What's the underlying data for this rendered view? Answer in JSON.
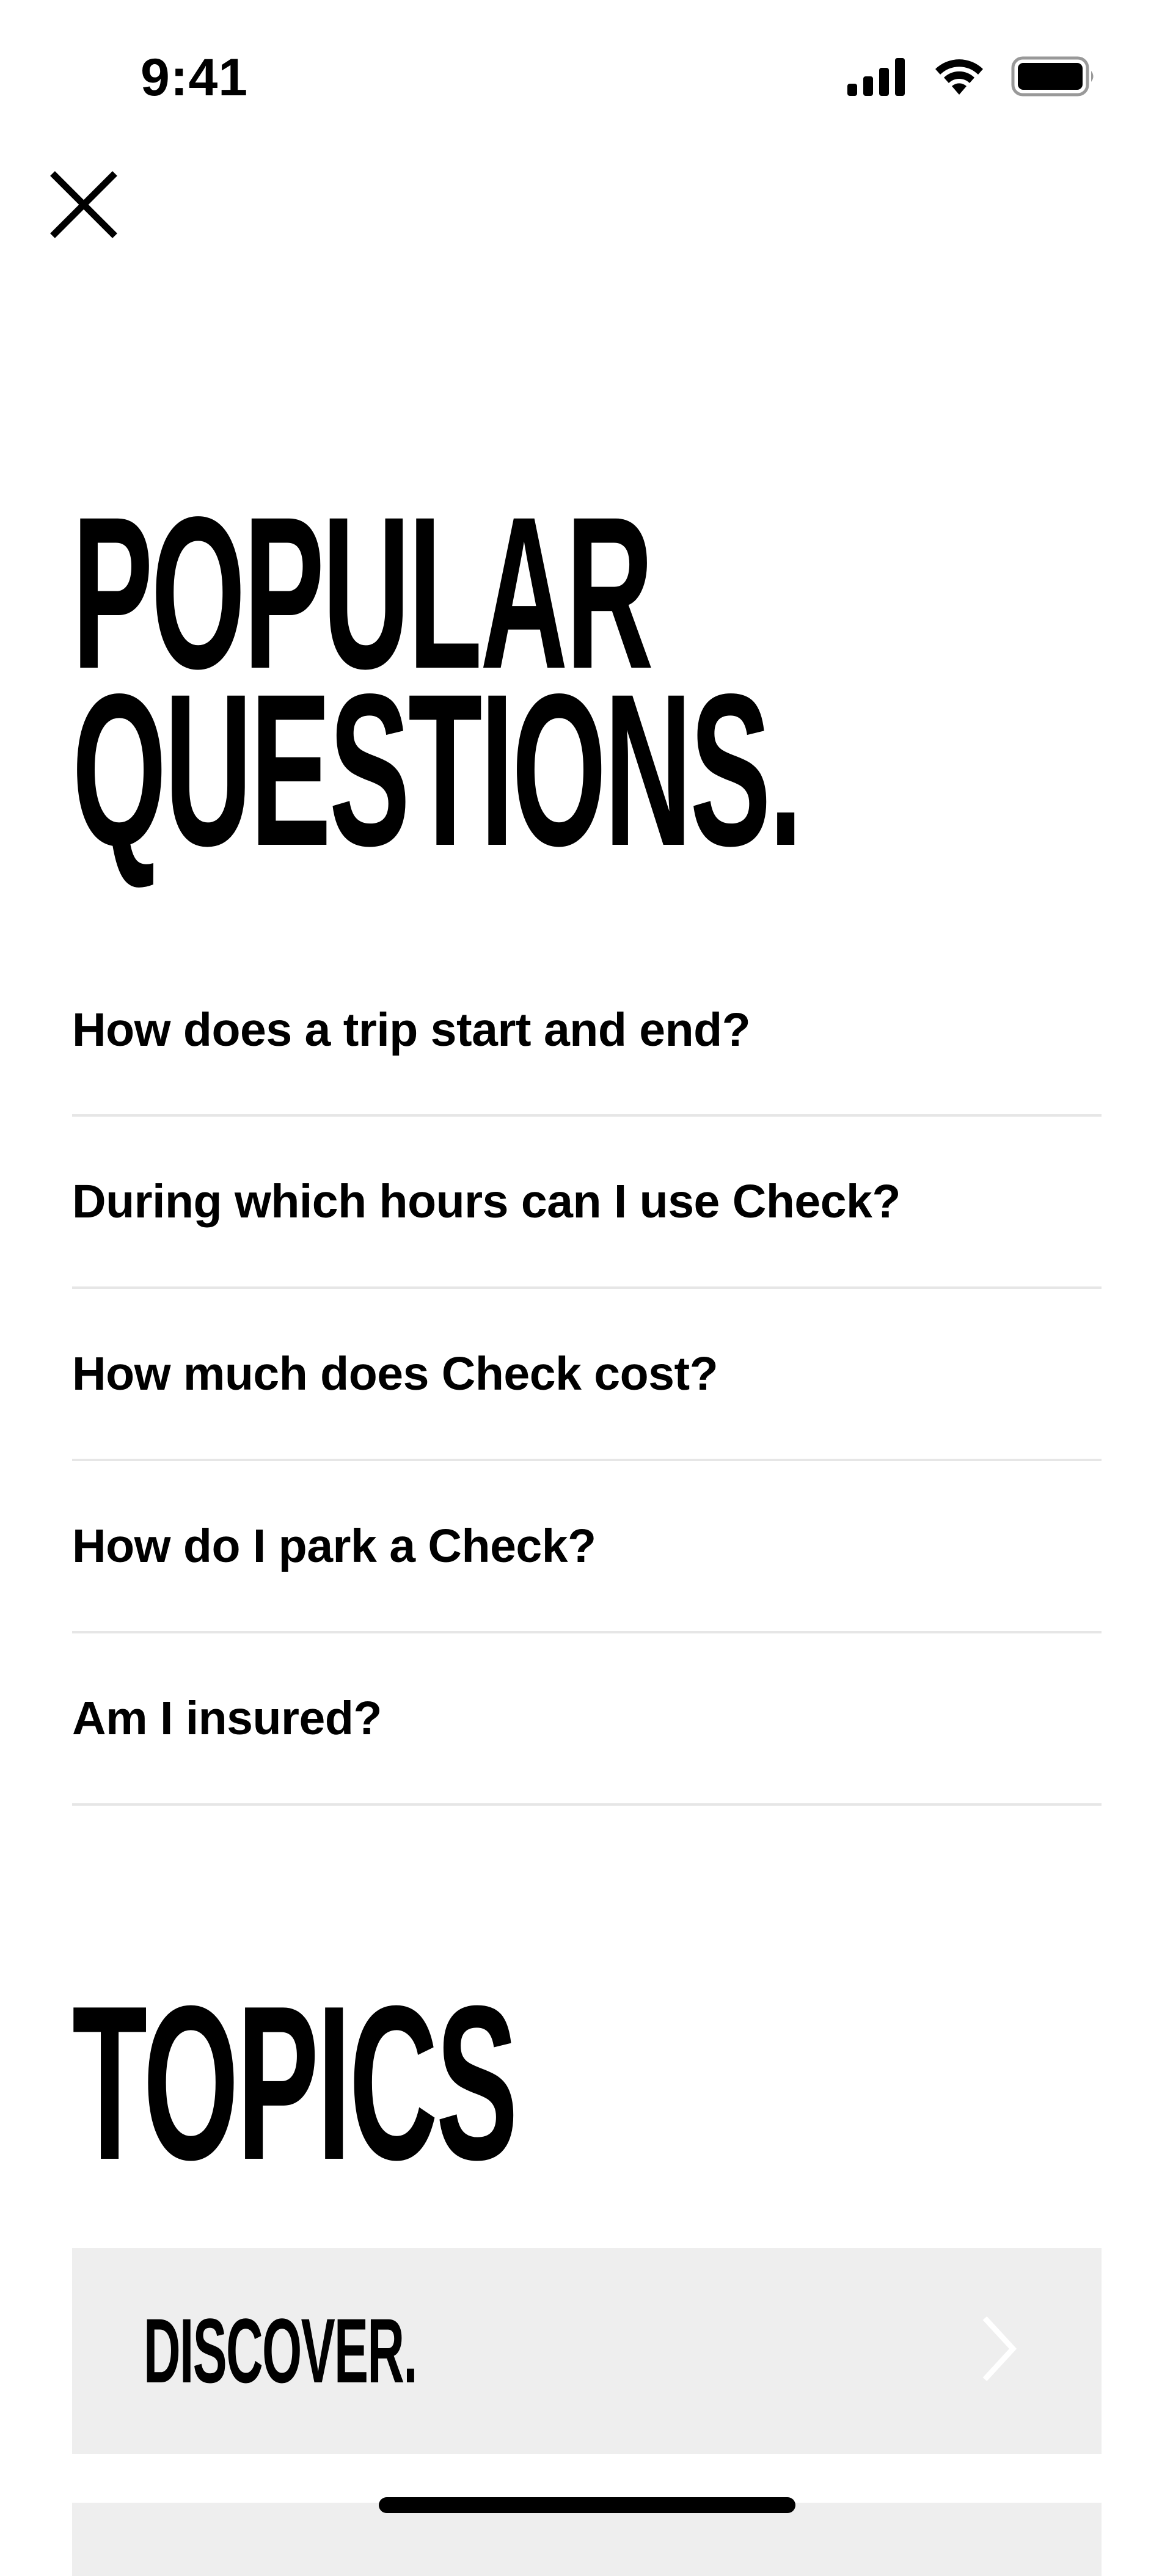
{
  "status_bar": {
    "time": "9:41",
    "icons": [
      "signal-icon",
      "wifi-icon",
      "battery-icon"
    ]
  },
  "close": {
    "icon": "close-icon"
  },
  "popular": {
    "title_line1": "POPULAR",
    "title_line2": "QUESTIONS.",
    "questions": [
      "How does a trip start and end?",
      "During which hours can I use Check?",
      "How much does Check cost?",
      "How do I park a Check?",
      "Am I insured?"
    ]
  },
  "topics": {
    "title": "TOPICS",
    "items": [
      {
        "label": "DISCOVER.",
        "icon": "chevron-right-icon"
      }
    ]
  },
  "colors": {
    "background": "#ffffff",
    "text": "#000000",
    "divider": "#e6e6e6",
    "card": "#eeeeee",
    "chevron": "#ffffff"
  }
}
